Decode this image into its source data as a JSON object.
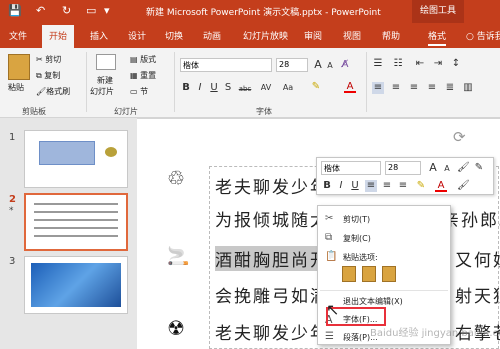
{
  "titlebar": {
    "title": "新建 Microsoft PowerPoint 演示文稿.pptx - PowerPoint",
    "context_tab_group": "绘图工具",
    "qa_save": "💾",
    "qa_undo": "↶",
    "qa_redo": "↻",
    "qa_present": "▭",
    "qa_more": "▾"
  },
  "tabs": [
    "文件",
    "开始",
    "插入",
    "设计",
    "切换",
    "动画",
    "幻灯片放映",
    "审阅",
    "视图",
    "帮助",
    "格式"
  ],
  "tell_me": "告诉我",
  "ribbon": {
    "paste": "粘贴",
    "cut": "剪切",
    "copy": "复制",
    "format_painter": "格式刷",
    "clipboard_group": "剪贴板",
    "new_slide": "新建",
    "new_slide_2": "幻灯片",
    "layout": "版式",
    "reset": "重置",
    "section": "节",
    "slides_group": "幻灯片",
    "font_name": "楷体",
    "font_size": "28",
    "font_group": "字体",
    "bold": "B",
    "italic": "I",
    "underline": "U",
    "strike": "S",
    "abc": "abc",
    "av": "AV",
    "aa": "Aa",
    "font_color": "A",
    "grow": "A",
    "shrink": "A"
  },
  "slides": [
    {
      "num": "1"
    },
    {
      "num": "2",
      "star": "*"
    },
    {
      "num": "3"
    }
  ],
  "doc": {
    "line1": "老夫聊发少年",
    "line2": "为报倾城随太",
    "line2b": "亲孙郎。",
    "line3a": "酒酣胸胆尚开",
    "line3b": "又何妨",
    "line4": "会挽雕弓如满",
    "line4b": "射天狼。",
    "line5": "老夫聊发少年",
    "line5b": "右擎苍。"
  },
  "mini_toolbar": {
    "font_name": "楷体",
    "font_size": "28",
    "bold": "B",
    "italic": "I",
    "underline": "U",
    "font_color": "A"
  },
  "context_menu": {
    "cut": "剪切(T)",
    "copy": "复制(C)",
    "paste_options": "粘贴选项:",
    "exit_edit": "退出文本编辑(X)",
    "font": "字体(F)...",
    "paragraph": "段落(P)..."
  },
  "watermark": "Baidu经验 jingyan.baidu.com",
  "colors": {
    "accent": "#c43e1c",
    "highlight_box": "#e8303a"
  }
}
